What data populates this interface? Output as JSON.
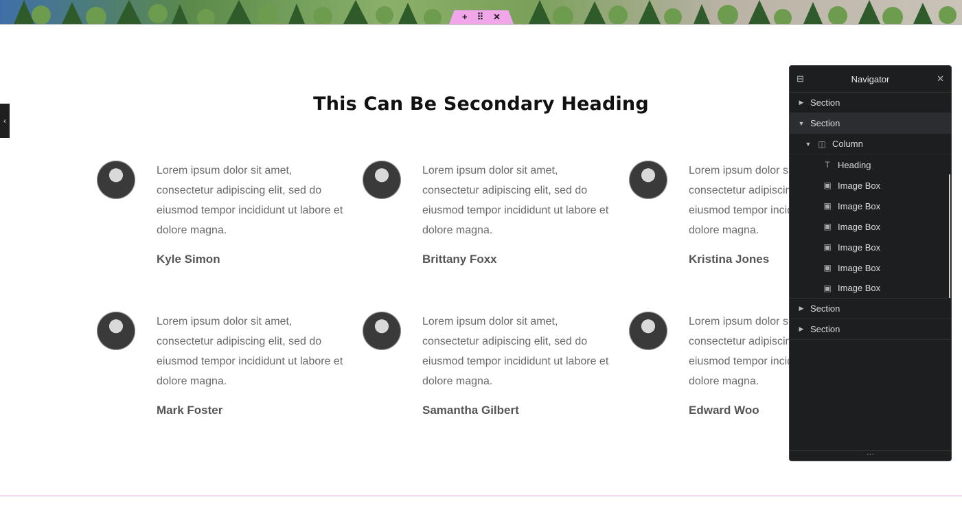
{
  "handle": {
    "add": "+",
    "move": "⠿",
    "close": "✕"
  },
  "left_toggle": "‹",
  "heading": "This Can Be Secondary Heading",
  "cards": [
    {
      "text": "Lorem ipsum dolor sit amet, consectetur adipiscing elit, sed do eiusmod tempor incididunt ut labore et dolore magna.",
      "name": "Kyle Simon"
    },
    {
      "text": "Lorem ipsum dolor sit amet, consectetur adipiscing elit, sed do eiusmod tempor incididunt ut labore et dolore magna.",
      "name": "Brittany Foxx"
    },
    {
      "text": "Lorem ipsum dolor sit amet, consectetur adipiscing elit, sed do eiusmod tempor incididunt ut labore et dolore magna.",
      "name": "Kristina Jones"
    },
    {
      "text": "Lorem ipsum dolor sit amet, consectetur adipiscing elit, sed do eiusmod tempor incididunt ut labore et dolore magna.",
      "name": "Mark Foster"
    },
    {
      "text": "Lorem ipsum dolor sit amet, consectetur adipiscing elit, sed do eiusmod tempor incididunt ut labore et dolore magna.",
      "name": "Samantha Gilbert"
    },
    {
      "text": "Lorem ipsum dolor sit amet, consectetur adipiscing elit, sed do eiusmod tempor incididunt ut labore et dolore magna.",
      "name": "Edward Woo"
    }
  ],
  "navigator": {
    "title": "Navigator",
    "collapse_icon": "⊟",
    "close_icon": "✕",
    "items": [
      {
        "label": "Section",
        "caret": "▶",
        "icon": ""
      },
      {
        "label": "Section",
        "caret": "▼",
        "icon": ""
      },
      {
        "label": "Column",
        "caret": "▼",
        "icon": "◫"
      },
      {
        "label": "Heading",
        "caret": "",
        "icon": "T"
      },
      {
        "label": "Image Box",
        "caret": "",
        "icon": "▣"
      },
      {
        "label": "Image Box",
        "caret": "",
        "icon": "▣"
      },
      {
        "label": "Image Box",
        "caret": "",
        "icon": "▣"
      },
      {
        "label": "Image Box",
        "caret": "",
        "icon": "▣"
      },
      {
        "label": "Image Box",
        "caret": "",
        "icon": "▣"
      },
      {
        "label": "Image Box",
        "caret": "",
        "icon": "▣"
      },
      {
        "label": "Section",
        "caret": "▶",
        "icon": ""
      },
      {
        "label": "Section",
        "caret": "▶",
        "icon": ""
      }
    ],
    "footer": "···"
  },
  "colors": {
    "accent_pink": "#f0a6e8",
    "panel_bg": "#1d1e20"
  }
}
